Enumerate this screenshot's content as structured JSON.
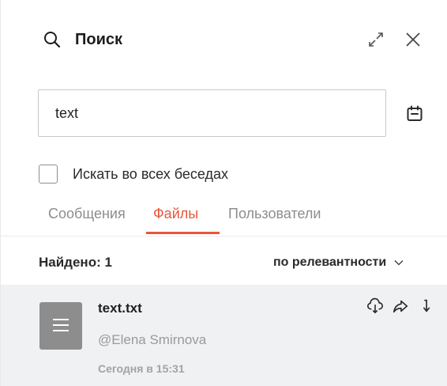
{
  "header": {
    "title": "Поиск",
    "search_icon": "search-icon",
    "expand_icon": "expand-icon",
    "close_icon": "close-icon"
  },
  "search": {
    "value": "text",
    "placeholder": "",
    "date_filter_icon": "calendar-icon"
  },
  "options": {
    "search_all_label": "Искать во всех беседах",
    "search_all_checked": false
  },
  "tabs": [
    {
      "label": "Сообщения",
      "active": false
    },
    {
      "label": "Файлы",
      "active": true
    },
    {
      "label": "Пользователи",
      "active": false
    }
  ],
  "results": {
    "found_label": "Найдено: 1",
    "sort_label": "по релевантности",
    "items": [
      {
        "name": "text.txt",
        "author": "@Elena Smirnova",
        "date": "Сегодня в 15:31",
        "icon": "file-icon",
        "actions": [
          "download-icon",
          "share-icon",
          "jump-icon"
        ]
      }
    ]
  },
  "colors": {
    "accent": "#e8563a",
    "row_background": "#f0f1f3",
    "muted_text": "#9a9a9a"
  }
}
